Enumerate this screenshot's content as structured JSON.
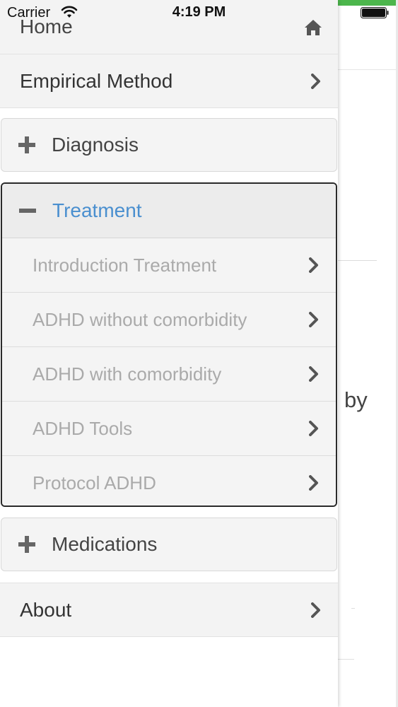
{
  "status_bar": {
    "carrier": "Carrier",
    "time": "4:19 PM"
  },
  "background": {
    "partial_text": "by"
  },
  "menu": {
    "home": {
      "label": "Home",
      "icon": "home-icon"
    },
    "empirical": {
      "label": "Empirical Method",
      "icon": "chevron-right-icon"
    },
    "diagnosis": {
      "label": "Diagnosis",
      "state": "collapsed",
      "icon": "plus-icon"
    },
    "treatment": {
      "label": "Treatment",
      "state": "expanded",
      "icon": "minus-icon",
      "items": [
        {
          "label": "Introduction Treatment"
        },
        {
          "label": "ADHD without comorbidity"
        },
        {
          "label": "ADHD with comorbidity"
        },
        {
          "label": "ADHD Tools"
        },
        {
          "label": "Protocol ADHD"
        }
      ]
    },
    "medications": {
      "label": "Medications",
      "state": "collapsed",
      "icon": "plus-icon"
    },
    "about": {
      "label": "About",
      "icon": "chevron-right-icon"
    }
  },
  "colors": {
    "accent": "#4a8fcf",
    "green_bar": "#4cb64c",
    "row_bg": "#f3f3f3",
    "muted_text": "#aaaaaa"
  }
}
